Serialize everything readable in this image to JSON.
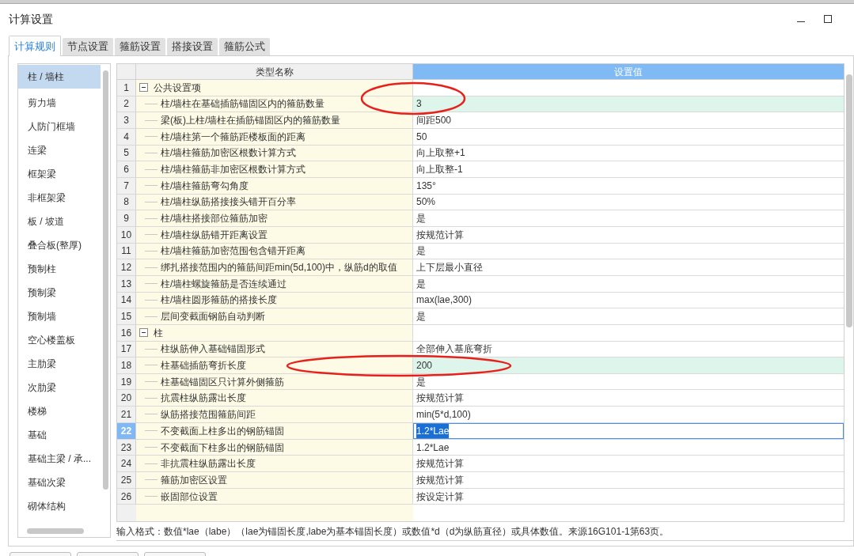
{
  "window": {
    "title": "计算设置"
  },
  "tabs": [
    {
      "label": "计算规则",
      "selected": true
    },
    {
      "label": "节点设置",
      "selected": false
    },
    {
      "label": "箍筋设置",
      "selected": false
    },
    {
      "label": "搭接设置",
      "selected": false
    },
    {
      "label": "箍筋公式",
      "selected": false
    }
  ],
  "sidebar": {
    "items": [
      {
        "label": "柱 / 墙柱",
        "selected": true
      },
      {
        "label": "剪力墙",
        "selected": false
      },
      {
        "label": "人防门框墙",
        "selected": false
      },
      {
        "label": "连梁",
        "selected": false
      },
      {
        "label": "框架梁",
        "selected": false
      },
      {
        "label": "非框架梁",
        "selected": false
      },
      {
        "label": "板 / 坡道",
        "selected": false
      },
      {
        "label": "叠合板(整厚)",
        "selected": false
      },
      {
        "label": "预制柱",
        "selected": false
      },
      {
        "label": "预制梁",
        "selected": false
      },
      {
        "label": "预制墙",
        "selected": false
      },
      {
        "label": "空心楼盖板",
        "selected": false
      },
      {
        "label": "主肋梁",
        "selected": false
      },
      {
        "label": "次肋梁",
        "selected": false
      },
      {
        "label": "楼梯",
        "selected": false
      },
      {
        "label": "基础",
        "selected": false
      },
      {
        "label": "基础主梁 / 承...",
        "selected": false
      },
      {
        "label": "基础次梁",
        "selected": false
      },
      {
        "label": "砌体结构",
        "selected": false
      }
    ]
  },
  "table": {
    "columns": [
      "类型名称",
      "设置值"
    ],
    "rows": [
      {
        "number": "1",
        "kind": "group",
        "expanded": true,
        "name": "公共设置项",
        "selected": false
      },
      {
        "number": "2",
        "kind": "item",
        "name": "柱/墙柱在基础插筋锚固区内的箍筋数量",
        "value": "3",
        "modified": true,
        "circled": true,
        "selected": false
      },
      {
        "number": "3",
        "kind": "item",
        "name": "梁(板)上柱/墙柱在插筋锚固区内的箍筋数量",
        "value": "间距500",
        "modified": false,
        "circled": false,
        "selected": false
      },
      {
        "number": "4",
        "kind": "item",
        "name": "柱/墙柱第一个箍筋距楼板面的距离",
        "value": "50",
        "modified": false,
        "circled": false,
        "selected": false
      },
      {
        "number": "5",
        "kind": "item",
        "name": "柱/墙柱箍筋加密区根数计算方式",
        "value": "向上取整+1",
        "modified": false,
        "circled": false,
        "selected": false
      },
      {
        "number": "6",
        "kind": "item",
        "name": "柱/墙柱箍筋非加密区根数计算方式",
        "value": "向上取整-1",
        "modified": false,
        "circled": false,
        "selected": false
      },
      {
        "number": "7",
        "kind": "item",
        "name": "柱/墙柱箍筋弯勾角度",
        "value": "135°",
        "modified": false,
        "circled": false,
        "selected": false
      },
      {
        "number": "8",
        "kind": "item",
        "name": "柱/墙柱纵筋搭接接头错开百分率",
        "value": "50%",
        "modified": false,
        "circled": false,
        "selected": false
      },
      {
        "number": "9",
        "kind": "item",
        "name": "柱/墙柱搭接部位箍筋加密",
        "value": "是",
        "modified": false,
        "circled": false,
        "selected": false
      },
      {
        "number": "10",
        "kind": "item",
        "name": "柱/墙柱纵筋错开距离设置",
        "value": "按规范计算",
        "modified": false,
        "circled": false,
        "selected": false
      },
      {
        "number": "11",
        "kind": "item",
        "name": "柱/墙柱箍筋加密范围包含错开距离",
        "value": "是",
        "modified": false,
        "circled": false,
        "selected": false
      },
      {
        "number": "12",
        "kind": "item",
        "name": "绑扎搭接范围内的箍筋间距min(5d,100)中，纵筋d的取值",
        "value": "上下层最小直径",
        "modified": false,
        "circled": false,
        "selected": false
      },
      {
        "number": "13",
        "kind": "item",
        "name": "柱/墙柱螺旋箍筋是否连续通过",
        "value": "是",
        "modified": false,
        "circled": false,
        "selected": false
      },
      {
        "number": "14",
        "kind": "item",
        "name": "柱/墙柱圆形箍筋的搭接长度",
        "value": "max(lae,300)",
        "modified": false,
        "circled": false,
        "selected": false
      },
      {
        "number": "15",
        "kind": "item",
        "name": "层间变截面钢筋自动判断",
        "value": "是",
        "modified": false,
        "circled": false,
        "selected": false
      },
      {
        "number": "16",
        "kind": "group",
        "expanded": true,
        "name": "柱",
        "selected": false
      },
      {
        "number": "17",
        "kind": "item",
        "name": "柱纵筋伸入基础锚固形式",
        "value": "全部伸入基底弯折",
        "modified": false,
        "circled": false,
        "selected": false
      },
      {
        "number": "18",
        "kind": "item",
        "name": "柱基础插筋弯折长度",
        "value": "200",
        "modified": true,
        "circled": true,
        "selected": false
      },
      {
        "number": "19",
        "kind": "item",
        "name": "柱基础锚固区只计算外侧箍筋",
        "value": "是",
        "modified": false,
        "circled": false,
        "selected": false
      },
      {
        "number": "20",
        "kind": "item",
        "name": "抗震柱纵筋露出长度",
        "value": "按规范计算",
        "modified": false,
        "circled": false,
        "selected": false
      },
      {
        "number": "21",
        "kind": "item",
        "name": "纵筋搭接范围箍筋间距",
        "value": "min(5*d,100)",
        "modified": false,
        "circled": false,
        "selected": false
      },
      {
        "number": "22",
        "kind": "item",
        "name": "不变截面上柱多出的钢筋锚固",
        "value": "1.2*Lae",
        "modified": false,
        "circled": false,
        "selected": true
      },
      {
        "number": "23",
        "kind": "item",
        "name": "不变截面下柱多出的钢筋锚固",
        "value": "1.2*Lae",
        "modified": false,
        "circled": false,
        "selected": false
      },
      {
        "number": "24",
        "kind": "item",
        "name": "非抗震柱纵筋露出长度",
        "value": "按规范计算",
        "modified": false,
        "circled": false,
        "selected": false
      },
      {
        "number": "25",
        "kind": "item",
        "name": "箍筋加密区设置",
        "value": "按规范计算",
        "modified": false,
        "circled": false,
        "selected": false
      },
      {
        "number": "26",
        "kind": "item",
        "name": "嵌固部位设置",
        "value": "按设定计算",
        "modified": false,
        "circled": false,
        "selected": false
      }
    ]
  },
  "hint": "输入格式：数值*lae（labe）（lae为锚固长度,labe为基本锚固长度）或数值*d（d为纵筋直径）或具体数值。来源16G101-1第63页。"
}
